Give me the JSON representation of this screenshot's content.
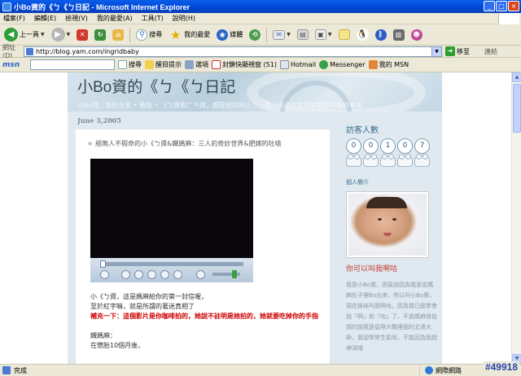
{
  "window": {
    "title": "小Bo資的《ㄅ《ㄅ日記 - Microsoft Internet Explorer",
    "buttons": [
      "_",
      "□",
      "×"
    ]
  },
  "menubar": {
    "items": [
      "檔案(F)",
      "編輯(E)",
      "檢視(V)",
      "我的最愛(A)",
      "工具(T)",
      "說明(H)"
    ]
  },
  "toolbar": {
    "back_label": "上一頁",
    "search_label": "搜尋",
    "favorites_label": "我的最愛",
    "media_label": "媒體"
  },
  "addressbar": {
    "label": "網址(D)",
    "url": "http://blog.yam.com/ingridbaby",
    "go_label": "移至",
    "links_label": "連結"
  },
  "msnbar": {
    "logo": "msn",
    "search_label": "搜尋",
    "highlight_label": "醒目提示",
    "options_label": "選項",
    "popup_label": "封鎖快顯視窗 (51)",
    "hotmail_label": "Hotmail",
    "messenger_label": "Messenger",
    "mymsn_label": "我的 MSN"
  },
  "blog": {
    "title": "小Bo資的《ㄅ《ㄅ日記",
    "description": "小Bo資，我的全名 • 黃楷 • 《ㄅ資和ㄏㄢ資，都是他的叫小ㄅㄧ資，不過生氣起來都會叫我的本名",
    "date": "June 3,2005",
    "post": {
      "title": "絕無人不假命的小《ㄅ資&鐵媽麻：三人的奇妙世界&肥嫁的吐嗆",
      "lines": [
        {
          "text": "小《ㄅ資，這是媽麻給你的第一封信喔，",
          "style": "normal"
        },
        {
          "text": "至於紅字嘛，就是所謂的著迷真相了",
          "style": "normal"
        },
        {
          "text": "補充一下：這個影片是你咖啡拍的，她說不註明是她拍的，她就要吃掉你的手指",
          "style": "red"
        },
        {
          "text": "",
          "style": "gap"
        },
        {
          "text": "鐵媽麻：",
          "style": "normal"
        },
        {
          "text": "在懷胎10個月後，",
          "style": "normal"
        }
      ]
    },
    "sidebar": {
      "visitors_title": "訪客人數",
      "counter": [
        "0",
        "0",
        "1",
        "0",
        "7"
      ],
      "profile_label": "個人簡介",
      "profile_subtitle": "你可以叫我啊咕",
      "bio": "我是小Bo資，把拔說因為我是從媽麻肚子裡Bo出來，所以叫小Bo資，現在妹妹叫我啊咕，因為我已經學會說「啊」和「咕」了，不過媽麻很低調的說我是星際大戰裡面的尤達大師，我卻常常生氣呢，不能因為我超神深嘻"
    }
  },
  "statusbar": {
    "status": "完成",
    "zone": "網際網路"
  },
  "watermark": "#49918"
}
